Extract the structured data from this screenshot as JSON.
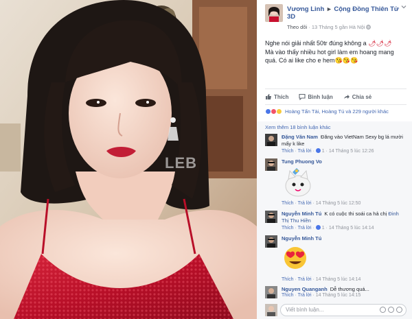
{
  "photo": {
    "watermark": "LEB",
    "description_icon": "portrait-photo"
  },
  "post": {
    "author": "Vương Linh",
    "separator": "▸",
    "group": "Cộng Đồng Thiên Tử 3D",
    "follow_label": "Theo dõi",
    "meta_dot": "·",
    "time": "13 Tháng 5 gần Hà Nội",
    "globe_icon": "globe-icon",
    "text_line1": "Nghe nói giải nhất 50tr đúng không a",
    "text_line1_emoji": "🌶🌶🌶",
    "text_line2": "Mà vào thấy nhiều hot girl làm em hoang mang quá. Có ai like cho e hem",
    "text_line2_emoji": "😘😘😘",
    "actions": {
      "like": "Thích",
      "comment": "Bình luận",
      "share": "Chia sẻ"
    },
    "reactions_text": "Hoàng Tấn Tài, Hoàng Tú và 229 người khác"
  },
  "comments": {
    "more_label": "Xem thêm 18 bình luận khác",
    "items": [
      {
        "name": "Đặng Văn Nam",
        "text": "Đăng vào VietNam Sexy bg lá mười mấy k like",
        "like": "Thích",
        "reply": "Trả lời",
        "count": "1",
        "time": "14 Tháng 5 lúc 12:26"
      },
      {
        "name": "Tung Phuong Vo",
        "text": "",
        "like": "Thích",
        "reply": "Trả lời",
        "time": "14 Tháng 5 lúc 12:50"
      },
      {
        "name": "Nguyễn Minh Tú",
        "text_prefix": "K có cuộc thi soái ca hả chị",
        "tag": "Đinh Thị Thu Hiền",
        "like": "Thích",
        "reply": "Trả lời",
        "count": "1",
        "time": "14 Tháng 5 lúc 14:14"
      },
      {
        "name": "Nguyễn Minh Tú",
        "text": "",
        "like": "Thích",
        "reply": "Trả lời",
        "time": "14 Tháng 5 lúc 14:14"
      },
      {
        "name": "Nguyen Quanganh",
        "text": "Dễ thương quá...",
        "like": "Thích",
        "reply": "Trả lời",
        "time": "14 Tháng 5 lúc 14:15"
      }
    ]
  },
  "composer": {
    "placeholder": "Viết bình luận..."
  },
  "colors": {
    "link": "#365899",
    "accent": "#4267b2",
    "muted": "#90949c",
    "dress": "#c8102e"
  }
}
